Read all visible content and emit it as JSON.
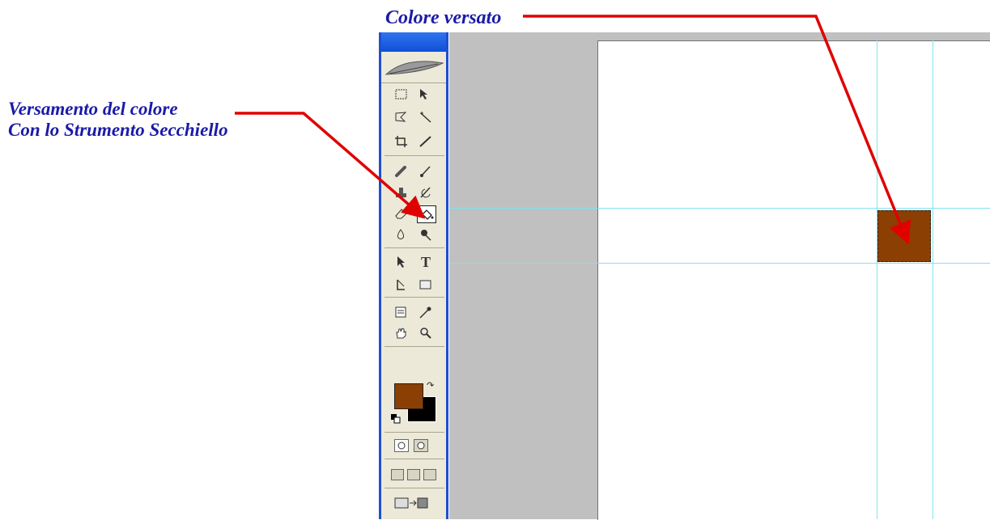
{
  "annotations": {
    "colore_versato": "Colore versato",
    "versamento_line1": "Versamento del colore",
    "versamento_line2": "Con lo Strumento Secchiello"
  },
  "toolbox": {
    "tools": [
      {
        "name": "rectangular-marquee-icon"
      },
      {
        "name": "move-icon"
      },
      {
        "name": "lasso-icon"
      },
      {
        "name": "magic-wand-icon"
      },
      {
        "name": "crop-icon"
      },
      {
        "name": "slice-icon"
      },
      {
        "name": "healing-brush-icon"
      },
      {
        "name": "brush-icon"
      },
      {
        "name": "clone-stamp-icon"
      },
      {
        "name": "history-brush-icon"
      },
      {
        "name": "eraser-icon"
      },
      {
        "name": "paint-bucket-icon",
        "selected": true
      },
      {
        "name": "blur-icon"
      },
      {
        "name": "dodge-icon"
      },
      {
        "name": "path-selection-icon"
      },
      {
        "name": "type-icon",
        "text": "T"
      },
      {
        "name": "pen-icon"
      },
      {
        "name": "shape-icon"
      },
      {
        "name": "notes-icon"
      },
      {
        "name": "eyedropper-icon"
      },
      {
        "name": "hand-icon"
      },
      {
        "name": "zoom-icon"
      }
    ],
    "foreground_color": "#8b3f02",
    "background_color": "#000000"
  },
  "canvas": {
    "filled_color": "#8b3f02",
    "guide_color": "#7fe6ee",
    "workspace_color": "#c0c0c0"
  },
  "arrow_color": "#e00000"
}
